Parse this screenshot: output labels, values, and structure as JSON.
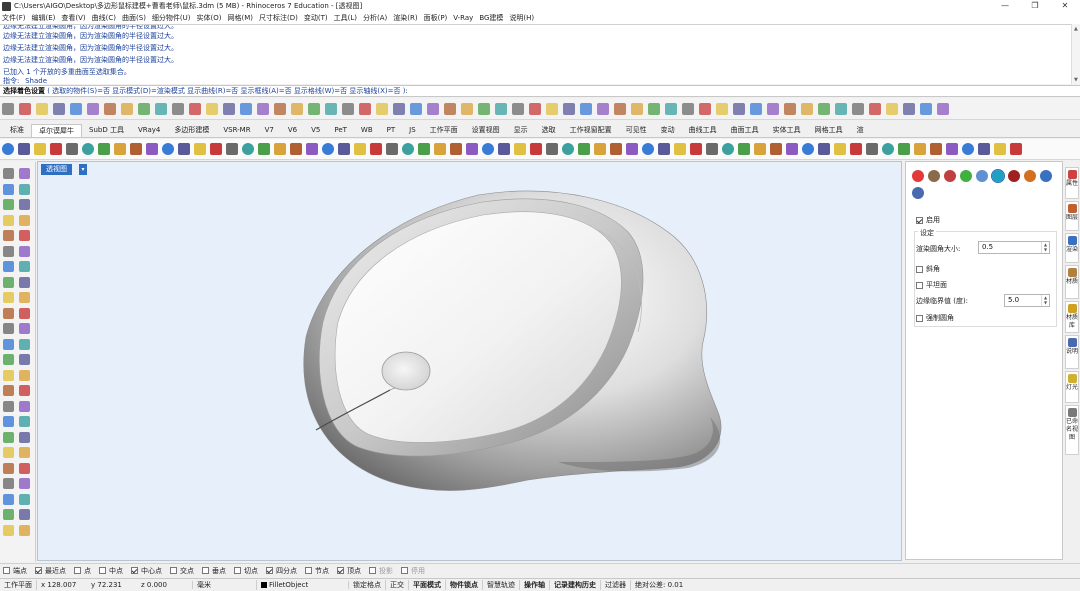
{
  "window": {
    "title": "C:\\Users\\AIGO\\Desktop\\多边形鼠标建模+曹看老师\\鼠标.3dm (5 MB) - Rhinoceros 7 Education - [透视图]",
    "minimize": "—",
    "maximize": "❐",
    "close": "✕"
  },
  "menu": [
    "文件(F)",
    "编辑(E)",
    "查看(V)",
    "曲线(C)",
    "曲面(S)",
    "细分物件(U)",
    "实体(O)",
    "网格(M)",
    "尺寸标注(D)",
    "变动(T)",
    "工具(L)",
    "分析(A)",
    "渲染(R)",
    "面板(P)",
    "V-Ray",
    "BG建模",
    "说明(H)"
  ],
  "history": {
    "partial": "边缘无法建立渲染圆角，因为渲染圆角的半径设置过大。",
    "lines": [
      "边缘无法建立渲染圆角，因为渲染圆角的半径设置过大。",
      "边缘无法建立渲染圆角，因为渲染圆角的半径设置过大。",
      "边缘无法建立渲染圆角，因为渲染圆角的半径设置过大。",
      "已加入 1 个开放的多重曲面至选取集合。",
      "指令: _Shade"
    ]
  },
  "command": {
    "prompt": "选择着色设置",
    "options": " ( 选取的物件(S)=否 显示模式(D)=渲染模式 显示曲线(R)=否 显示框线(A)=否 显示格线(W)=否 显示轴线(X)=否 ):"
  },
  "tabs": [
    "标准",
    "卓尔谟犀牛",
    "SubD 工具",
    "VRay4",
    "多边形建模",
    "VSR-MR",
    "V7",
    "V6",
    "V5",
    "PeT",
    "WB",
    "PT",
    "JS",
    "工作平面",
    "设置视图",
    "显示",
    "选取",
    "工作视窗配置",
    "可见性",
    "变动",
    "曲线工具",
    "曲面工具",
    "实体工具",
    "网格工具",
    "渲"
  ],
  "active_tab": "卓尔谟犀牛",
  "viewport": {
    "label": "透视图",
    "menu_arrow": "▾"
  },
  "panel": {
    "enable_label": "启用",
    "enable_checked": true,
    "settings_label": "设定",
    "fillet_radius_label": "渲染圆角大小:",
    "fillet_radius_value": "0.5",
    "chamfer_label": "斜角",
    "chamfer_checked": false,
    "planar_label": "平坦面",
    "planar_checked": false,
    "edge_angle_label": "边缘临界值 (度):",
    "edge_angle_value": "5.0",
    "force_fillet_label": "强制圆角",
    "force_fillet_checked": false
  },
  "side_tabs": [
    "属性",
    "图层",
    "渲染",
    "材质",
    "材质库",
    "说明",
    "灯光",
    "已命名视图"
  ],
  "osnap": [
    {
      "label": "端点",
      "checked": false,
      "enabled": true
    },
    {
      "label": "最近点",
      "checked": true,
      "enabled": true
    },
    {
      "label": "点",
      "checked": false,
      "enabled": true
    },
    {
      "label": "中点",
      "checked": false,
      "enabled": true
    },
    {
      "label": "中心点",
      "checked": true,
      "enabled": true
    },
    {
      "label": "交点",
      "checked": false,
      "enabled": true
    },
    {
      "label": "垂点",
      "checked": false,
      "enabled": true
    },
    {
      "label": "切点",
      "checked": false,
      "enabled": true
    },
    {
      "label": "四分点",
      "checked": true,
      "enabled": true
    },
    {
      "label": "节点",
      "checked": false,
      "enabled": true
    },
    {
      "label": "顶点",
      "checked": true,
      "enabled": true
    },
    {
      "label": "投影",
      "checked": false,
      "enabled": false
    },
    {
      "label": "停用",
      "checked": false,
      "enabled": false
    }
  ],
  "status": {
    "cplane": "工作平面",
    "x": "x 128.007",
    "y": "y 72.231",
    "z": "z 0.000",
    "unit": "毫米",
    "layer": "FilletObject",
    "grid_snap": "锁定格点",
    "ortho": "正交",
    "planar": "平面模式",
    "osnap": "物件锁点",
    "smarttrack": "智慧轨迹",
    "gumball": "操作轴",
    "history": "记录建构历史",
    "filter": "过滤器",
    "tolerance": "绝对公差: 0.01"
  },
  "colors": {
    "accent": "#2f6fc2",
    "viewport_bg": "#e7f0fa",
    "history_text": "#1a3f99"
  }
}
